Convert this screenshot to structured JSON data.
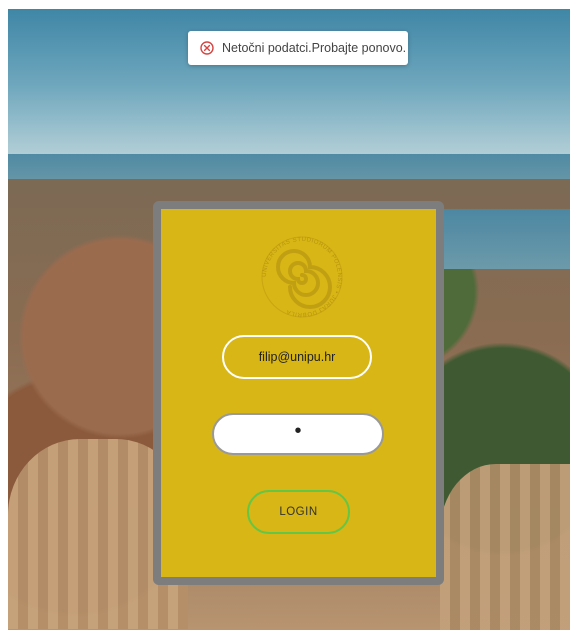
{
  "toast": {
    "icon": "error-x-circle-icon",
    "message": "Netočni podatci.Probajte ponovo."
  },
  "login_form": {
    "logo_icon": "spiral-university-seal-icon",
    "logo_text": "UNIVERSITAS STUDIORUM POLENSIS • JURAJ DOBRILA",
    "email_value": "filip@unipu.hr",
    "password_value": "•",
    "login_label": "LOGIN"
  },
  "colors": {
    "card_yellow": "#d7b616",
    "card_border": "#7d7d7d",
    "login_border": "#63c646",
    "error_red": "#d64541"
  }
}
